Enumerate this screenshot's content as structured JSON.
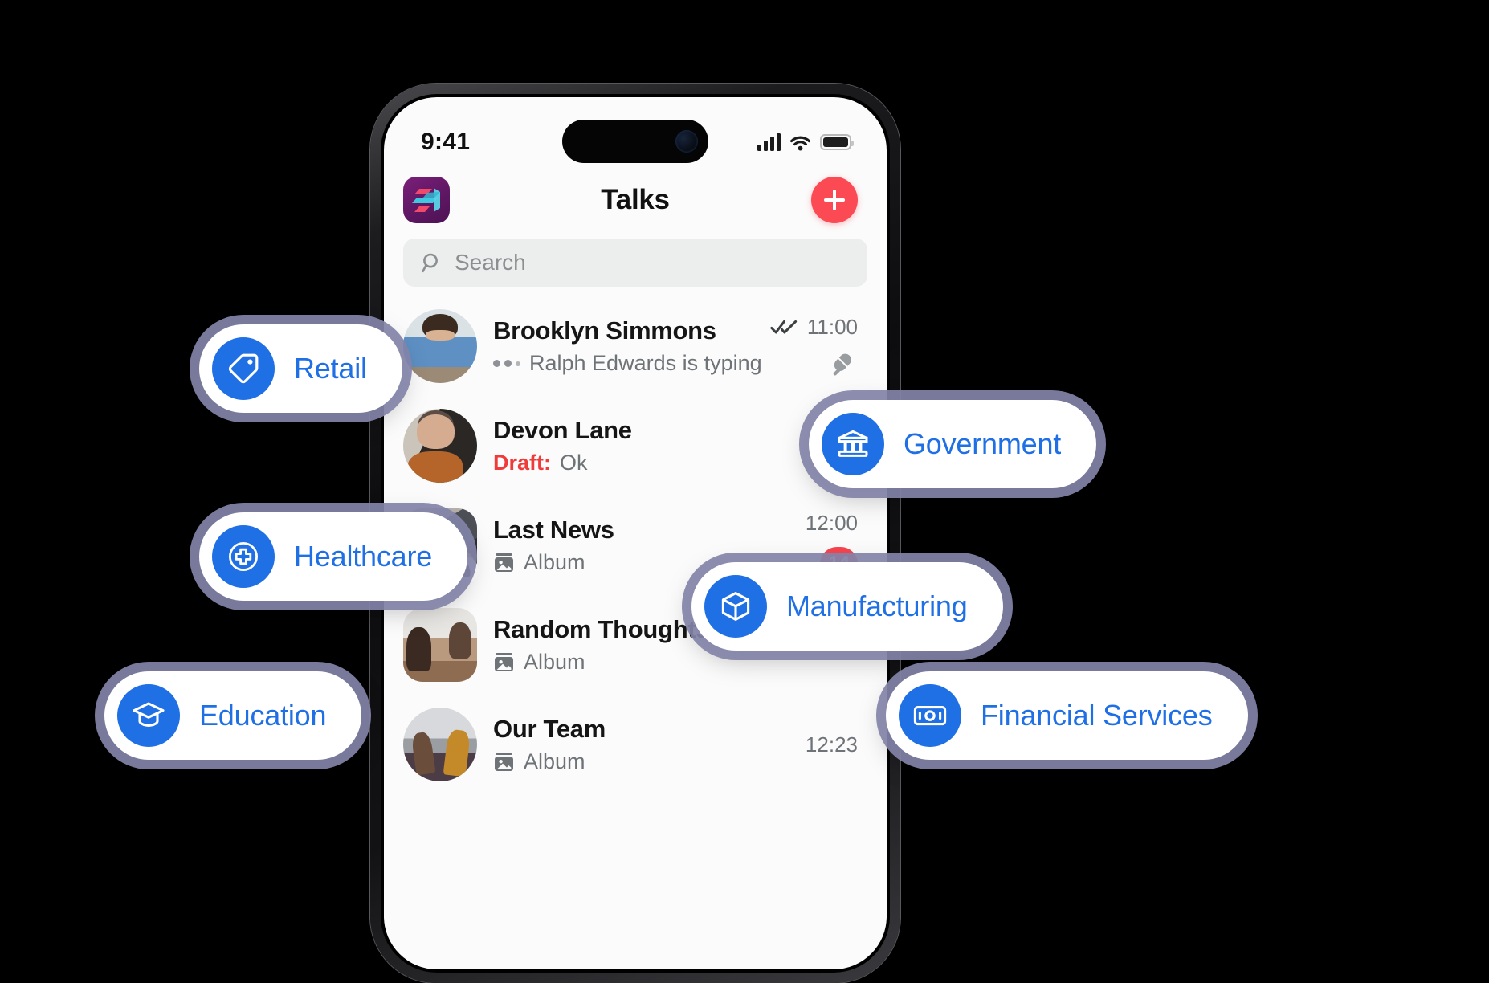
{
  "colors": {
    "accent_blue": "#1f6fe5",
    "badge_red": "#f8444f",
    "add_button_red": "#fb4a54",
    "draft_red": "#f03b3b",
    "logo_purple": "#5f1763",
    "logo_cyan": "#3fc9e0",
    "logo_pink": "#ef4a6b",
    "pill_shadow": "#8283a8",
    "search_bg": "#eceded",
    "screen_bg": "#fbfbfb"
  },
  "status_bar": {
    "time": "9:41",
    "signal_icon": "cellular-bars-icon",
    "wifi_icon": "wifi-icon",
    "battery_icon": "battery-full-icon"
  },
  "nav_bar": {
    "logo_icon": "app-logo-icon",
    "title": "Talks",
    "add_button_icon": "plus-icon"
  },
  "search": {
    "icon": "search-icon",
    "placeholder": "Search",
    "value": ""
  },
  "chats": [
    {
      "name": "Brooklyn Simmons",
      "subtitle": "Ralph Edwards is typing",
      "subtitle_prefix": "",
      "time": "11:00",
      "avatar_shape": "circle",
      "avatar_name": "avatar-brooklyn-simmons",
      "status_icon": "double-check-icon",
      "pin_icon": "pin-icon",
      "typing_icon": "typing-dots-icon",
      "badge": "",
      "lock": false
    },
    {
      "name": "Devon Lane",
      "subtitle": "Ok",
      "subtitle_prefix": "Draft:",
      "time": "",
      "avatar_shape": "circle",
      "avatar_name": "avatar-devon-lane",
      "status_icon": "",
      "pin_icon": "",
      "typing_icon": "",
      "badge": "",
      "lock": false
    },
    {
      "name": "Last News",
      "subtitle": "Album",
      "subtitle_prefix": "",
      "time": "12:00",
      "avatar_shape": "rounded",
      "avatar_name": "avatar-last-news",
      "status_icon": "",
      "pin_icon": "",
      "typing_icon": "album-image-icon",
      "badge": "14",
      "lock": true
    },
    {
      "name": "Random Thoughts",
      "subtitle": "Album",
      "subtitle_prefix": "",
      "time": "",
      "avatar_shape": "rounded",
      "avatar_name": "avatar-random-thoughts",
      "status_icon": "",
      "pin_icon": "",
      "typing_icon": "album-image-icon",
      "badge": "",
      "lock": false
    },
    {
      "name": "Our Team",
      "subtitle": "Album",
      "subtitle_prefix": "",
      "time": "12:23",
      "avatar_shape": "circle",
      "avatar_name": "avatar-our-team",
      "status_icon": "",
      "pin_icon": "",
      "typing_icon": "album-image-icon",
      "badge": "",
      "lock": false
    }
  ],
  "industry_pills": [
    {
      "label": "Retail",
      "icon": "price-tag-icon"
    },
    {
      "label": "Healthcare",
      "icon": "medical-cross-icon"
    },
    {
      "label": "Education",
      "icon": "graduation-cap-icon"
    },
    {
      "label": "Government",
      "icon": "bank-building-icon"
    },
    {
      "label": "Manufacturing",
      "icon": "cube-box-icon"
    },
    {
      "label": "Financial Services",
      "icon": "banknote-icon"
    }
  ]
}
